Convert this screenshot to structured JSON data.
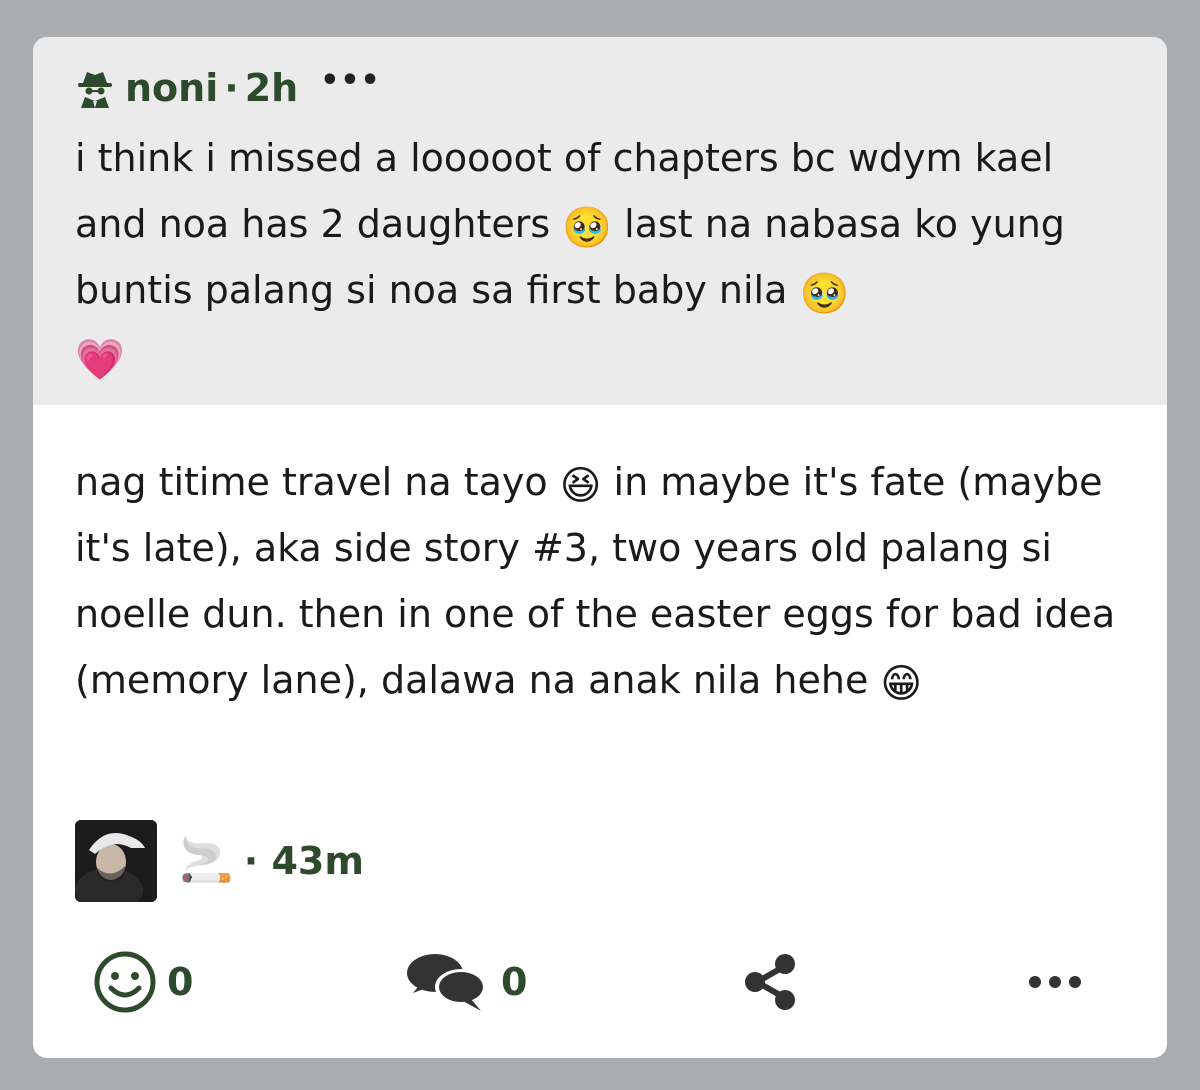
{
  "quoted_post": {
    "user_icon": "spy-icon",
    "username": "noni",
    "separator": "·",
    "time": "2h",
    "more_label": "•••",
    "text_before_emoji_1": "i think i missed a looooot of chapters bc wdym kael and noa has 2 daughters ",
    "emoji_1": "🥹",
    "text_before_emoji_2": " last na nabasa ko yung buntis palang si noa sa first baby nila ",
    "emoji_2": "🥹",
    "emoji_3": "💗"
  },
  "reply": {
    "text_part_1": "nag titime travel na tayo ",
    "emoji_1": "😆",
    "text_part_2": " in maybe it's fate (maybe it's late), aka side story #3, two years old palang si noelle dun. then in one of the easter eggs for bad idea (memory lane), dalawa na anak nila hehe ",
    "emoji_2": "😁",
    "author_emoji": "🚬",
    "separator": "·",
    "time": "43m"
  },
  "actions": {
    "reactions_icon": "smiley-icon",
    "reactions_count": "0",
    "comments_icon": "comments-icon",
    "comments_count": "0",
    "share_icon": "share-icon",
    "more_icon": "more-dots-icon"
  },
  "colors": {
    "background": "#a9adaf",
    "card": "#ffffff",
    "quoted_background": "#ebebeb",
    "accent_green": "#2e4a2c",
    "text": "#1a1a1a"
  }
}
